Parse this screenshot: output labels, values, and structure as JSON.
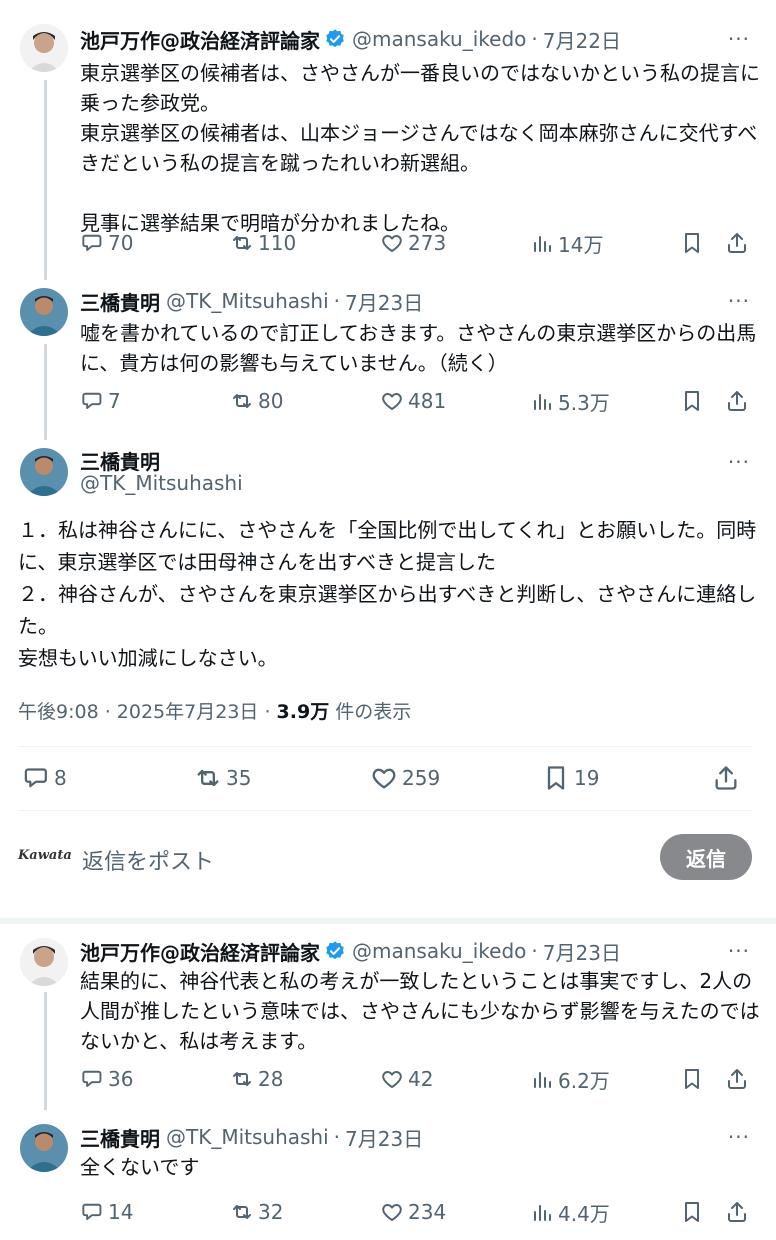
{
  "icons": {
    "reply": "speech-bubble-icon",
    "repost": "repost-arrows-icon",
    "like": "heart-icon",
    "views": "bar-chart-icon",
    "bookmark": "bookmark-icon",
    "share": "upload-share-icon",
    "verified": "verified-badge-icon",
    "more": "ellipsis-icon"
  },
  "colors": {
    "verified": "#1d9bf0",
    "secondary_text": "#536471",
    "reply_button": "#87898c"
  },
  "tweets": [
    {
      "name": "池戸万作@政治経済評論家",
      "handle": "@mansaku_ikedo",
      "sep": "·",
      "date": "7月22日",
      "more": "···",
      "text": "東京選挙区の候補者は、さやさんが一番良いのではないかという私の提言に乗った参政党。\n東京選挙区の候補者は、山本ジョージさんではなく岡本麻弥さんに交代すべきだという私の提言を蹴ったれいわ新選組。\n\n見事に選挙結果で明暗が分かれましたね。",
      "replies": "70",
      "reposts": "110",
      "likes": "273",
      "views": "14万"
    },
    {
      "name": "三橋貴明",
      "handle": "@TK_Mitsuhashi",
      "sep": "·",
      "date": "7月23日",
      "more": "···",
      "text": "嘘を書かれているので訂正しておきます。さやさんの東京選挙区からの出馬に、貴方は何の影響も与えていません。（続く）",
      "replies": "7",
      "reposts": "80",
      "likes": "481",
      "views": "5.3万"
    }
  ],
  "main_tweet": {
    "name": "三橋貴明",
    "handle": "@TK_Mitsuhashi",
    "more": "···",
    "text": "１．私は神谷さんにに、さやさんを「全国比例で出してくれ」とお願いした。同時に、東京選挙区では田母神さんを出すべきと提言した\n２．神谷さんが、さやさんを東京選挙区から出すべきと判断し、さやさんに連絡した。\n妄想もいい加減にしなさい。",
    "time": "午後9:08 · 2025年7月23日 · ",
    "view_count": "3.9万",
    "view_suffix": " 件の表示",
    "replies": "8",
    "reposts": "35",
    "likes": "259",
    "bookmarks": "19"
  },
  "reply_box": {
    "avatar_text": "Kawata",
    "placeholder": "返信をポスト",
    "button": "返信"
  },
  "replies": [
    {
      "name": "池戸万作@政治経済評論家",
      "handle": "@mansaku_ikedo",
      "sep": "·",
      "date": "7月23日",
      "more": "···",
      "text": "結果的に、神谷代表と私の考えが一致したということは事実ですし、2人の人間が推したという意味では、さやさんにも少なからず影響を与えたのではないかと、私は考えます。",
      "replies": "36",
      "reposts": "28",
      "likes": "42",
      "views": "6.2万"
    },
    {
      "name": "三橋貴明",
      "handle": "@TK_Mitsuhashi",
      "sep": "·",
      "date": "7月23日",
      "more": "···",
      "text": "全くないです",
      "replies": "14",
      "reposts": "32",
      "likes": "234",
      "views": "4.4万"
    }
  ]
}
